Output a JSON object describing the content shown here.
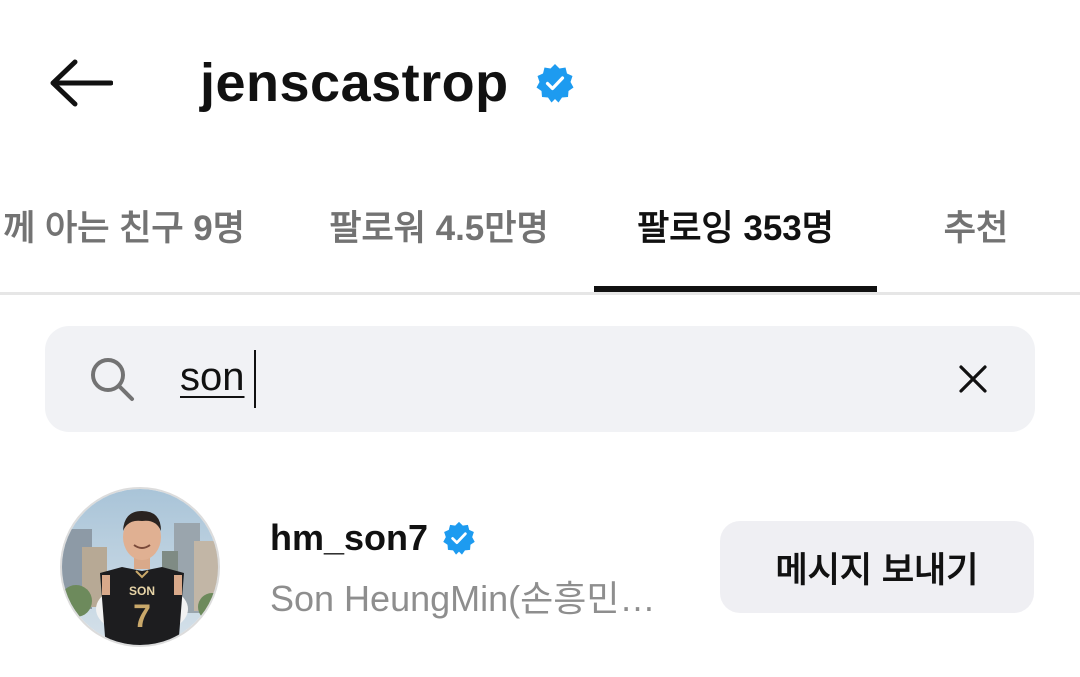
{
  "header": {
    "back_icon": "arrow-left-icon",
    "title": "jenscastrop",
    "verified_icon": "verified-badge-icon",
    "verified_color": "#1d9bf0"
  },
  "tabs": [
    {
      "label": "께 아는 친구 9명",
      "active": false
    },
    {
      "label": "팔로워 4.5만명",
      "active": false
    },
    {
      "label": "팔로잉 353명",
      "active": true
    },
    {
      "label": "추천",
      "active": false
    }
  ],
  "search": {
    "icon": "search-icon",
    "value": "son",
    "clear_icon": "close-icon"
  },
  "results": [
    {
      "username": "hm_son7",
      "verified": true,
      "full_name": "Son HeungMin(손흥민…",
      "button_label": "메시지 보내기",
      "jersey_name": "SON",
      "jersey_number": "7"
    }
  ]
}
